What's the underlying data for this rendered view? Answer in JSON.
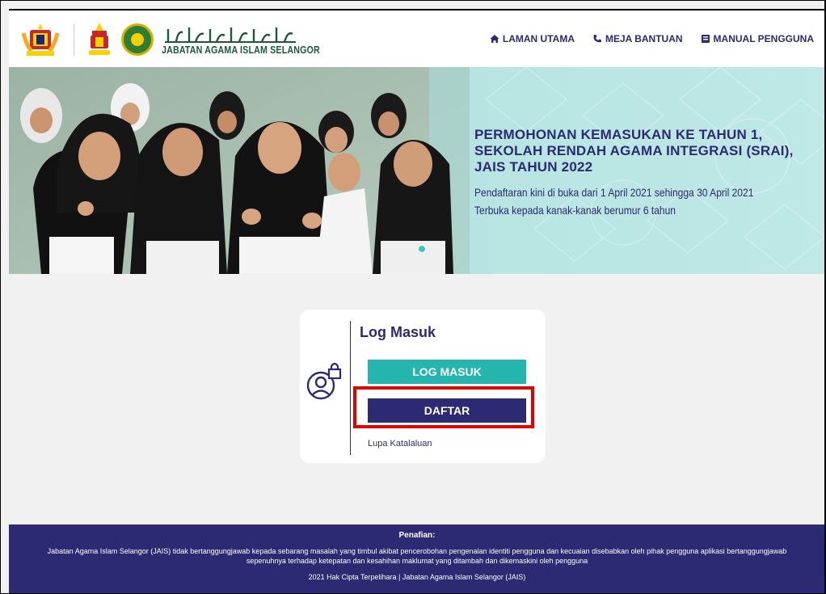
{
  "header": {
    "org_name": "JABATAN AGAMA ISLAM SELANGOR",
    "org_name_arabic": "جابتن اڬام اسلام سلاڠور",
    "nav": [
      {
        "label": "LAMAN UTAMA",
        "icon": "home-icon"
      },
      {
        "label": "MEJA BANTUAN",
        "icon": "phone-icon"
      },
      {
        "label": "MANUAL PENGGUNA",
        "icon": "book-icon"
      }
    ]
  },
  "banner": {
    "title_lines": [
      "PERMOHONAN KEMASUKAN KE TAHUN 1,",
      "SEKOLAH RENDAH AGAMA INTEGRASI (SRAI),",
      "JAIS TAHUN 2022"
    ],
    "subtitle_lines": [
      "Pendaftaran kini di buka dari 1 April 2021 sehingga 30 April 2021",
      "Terbuka kepada kanak-kanak berumur 6 tahun"
    ]
  },
  "login": {
    "title": "Log Masuk",
    "login_button": "LOG MASUK",
    "register_button": "DAFTAR",
    "forgot_link": "Lupa Katalaluan",
    "icon": "user-lock-icon"
  },
  "footer": {
    "title": "Penafian:",
    "disclaimer": "Jabatan Agama Islam Selangor (JAIS) tidak bertanggungjawab kepada sebarang masalah yang timbul akibat pencerobohan pengenalan identiti pengguna dan kecuaian disebabkan oleh pihak pengguna aplikasi bertanggungjawab sepenuhnya terhadap ketepatan dan kesahihan maklumat yang ditambah dan dikemaskini oleh pengguna",
    "copyright": "2021 Hak Cipta Terpelihara | Jabatan Agama Islam Selangor (JAIS)"
  },
  "colors": {
    "primary": "#2b2a72",
    "accent": "#23b5ae",
    "highlight": "#e00000",
    "banner_bg": "#b4e3e0"
  }
}
